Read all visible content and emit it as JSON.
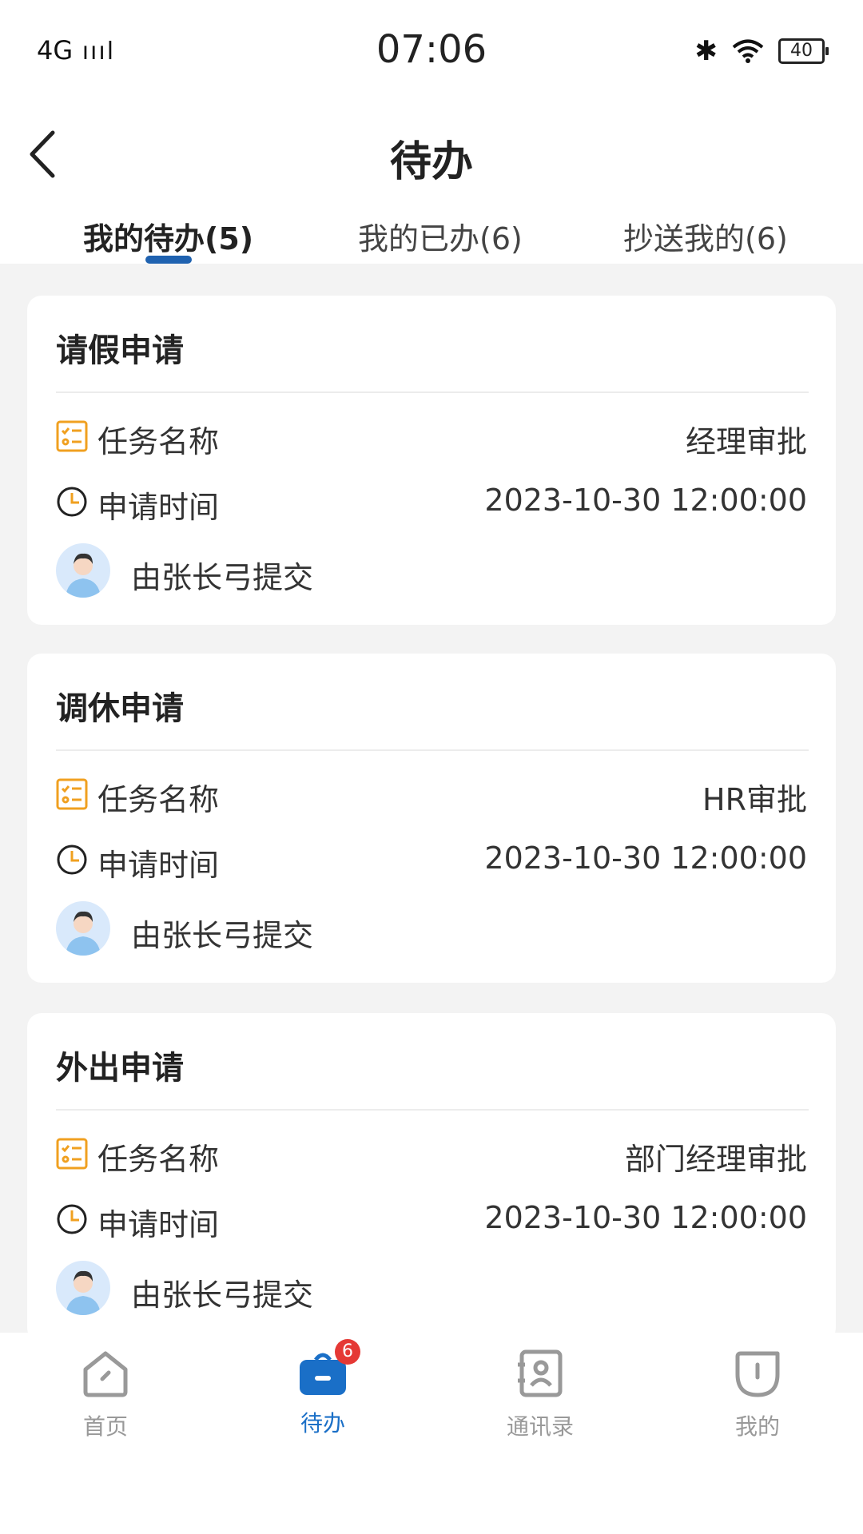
{
  "status_bar": {
    "signal": "4G",
    "time": "07:06",
    "battery": "40"
  },
  "header": {
    "title": "待办"
  },
  "tabs": [
    {
      "label": "我的待办(5)",
      "active": true
    },
    {
      "label": "我的已办(6)",
      "active": false
    },
    {
      "label": "抄送我的(6)",
      "active": false
    }
  ],
  "cards": [
    {
      "title": "请假申请",
      "task_label": "任务名称",
      "task_value": "经理审批",
      "time_label": "申请时间",
      "time_value": "2023-10-30 12:00:00",
      "submitter": "由张长弓提交"
    },
    {
      "title": "调休申请",
      "task_label": "任务名称",
      "task_value": "HR审批",
      "time_label": "申请时间",
      "time_value": "2023-10-30 12:00:00",
      "submitter": "由张长弓提交"
    },
    {
      "title": "外出申请",
      "task_label": "任务名称",
      "task_value": "部门经理审批",
      "time_label": "申请时间",
      "time_value": "2023-10-30 12:00:00",
      "submitter": "由张长弓提交"
    }
  ],
  "bottom_nav": [
    {
      "label": "首页",
      "icon": "home-icon",
      "active": false
    },
    {
      "label": "待办",
      "icon": "briefcase-icon",
      "active": true,
      "badge": "6"
    },
    {
      "label": "通讯录",
      "icon": "contacts-icon",
      "active": false
    },
    {
      "label": "我的",
      "icon": "profile-icon",
      "active": false
    }
  ],
  "colors": {
    "accent": "#1f62b0",
    "nav_active": "#1a6fc7",
    "badge": "#e53935",
    "task_icon": "#f0a020"
  }
}
